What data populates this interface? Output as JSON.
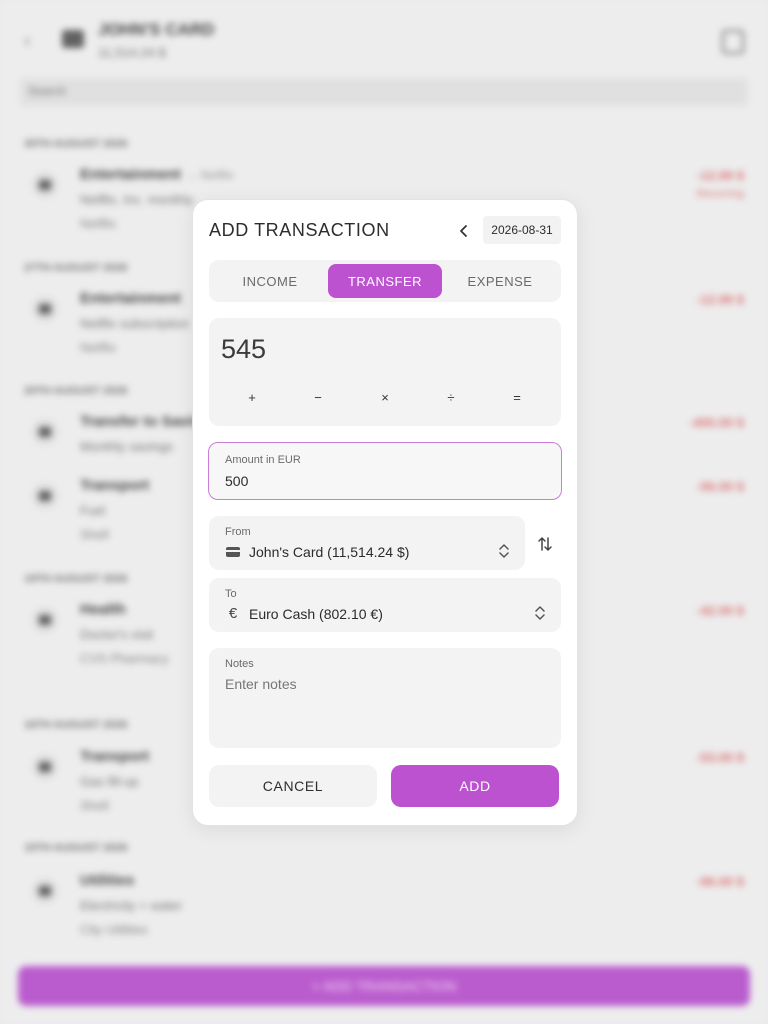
{
  "background": {
    "header_title": "JOHN'S CARD",
    "header_subtitle": "11,514.24 $",
    "search_placeholder": "Search",
    "add_button_label": "+ ADD TRANSACTION",
    "groups": [
      {
        "date": "30TH AUGUST 2026",
        "title": "Entertainment",
        "title_suffix": "→ Netflix",
        "line2": "Netflix, Inc. monthly",
        "line3": "Netflix",
        "amount": "-12.99 $",
        "amount2": "Recurring"
      },
      {
        "date": "27TH AUGUST 2026",
        "title": "Entertainment",
        "title_suffix": "",
        "line2": "Netflix subscription",
        "line3": "Netflix",
        "amount": "-12.99 $",
        "amount2": ""
      },
      {
        "date": "20TH AUGUST 2026",
        "title": "Transfer to Savings",
        "title_suffix": "",
        "line2": "Monthly savings",
        "line3": "",
        "amount": "-400.00 $",
        "amount2": ""
      },
      {
        "date": "",
        "title": "Transport",
        "title_suffix": "",
        "line2": "Fuel",
        "line3": "Shell",
        "amount": "-56.00 $",
        "amount2": ""
      },
      {
        "date": "19TH AUGUST 2026",
        "title": "Health",
        "title_suffix": "",
        "line2": "Doctor's visit",
        "line3": "CVS Pharmacy",
        "amount": "-42.00 $",
        "amount2": ""
      },
      {
        "date": "16TH AUGUST 2026",
        "title": "Transport",
        "title_suffix": "",
        "line2": "Gas fill-up",
        "line3": "Shell",
        "amount": "-53.00 $",
        "amount2": ""
      },
      {
        "date": "15TH AUGUST 2026",
        "title": "Utilities",
        "title_suffix": "",
        "line2": "Electricity + water",
        "line3": "City Utilities",
        "amount": "-96.00 $",
        "amount2": ""
      }
    ]
  },
  "dialog": {
    "title": "ADD TRANSACTION",
    "date": "2026-08-31",
    "tabs": [
      {
        "label": "INCOME",
        "active": false
      },
      {
        "label": "TRANSFER",
        "active": true
      },
      {
        "label": "EXPENSE",
        "active": false
      }
    ],
    "calculator": {
      "display": "545",
      "operators": [
        "+",
        "−",
        "×",
        "÷",
        "="
      ]
    },
    "amount": {
      "label": "Amount in EUR",
      "value": "500"
    },
    "from": {
      "label": "From",
      "value": "John's Card (11,514.24 $)",
      "icon": "card-icon"
    },
    "to": {
      "label": "To",
      "value": "Euro Cash (802.10 €)",
      "icon": "euro-icon",
      "glyph": "€"
    },
    "notes": {
      "label": "Notes",
      "placeholder": "Enter notes"
    },
    "cancel_label": "CANCEL",
    "add_label": "ADD",
    "colors": {
      "accent": "#bc52cf",
      "field_bg": "#f3f3f3"
    }
  }
}
